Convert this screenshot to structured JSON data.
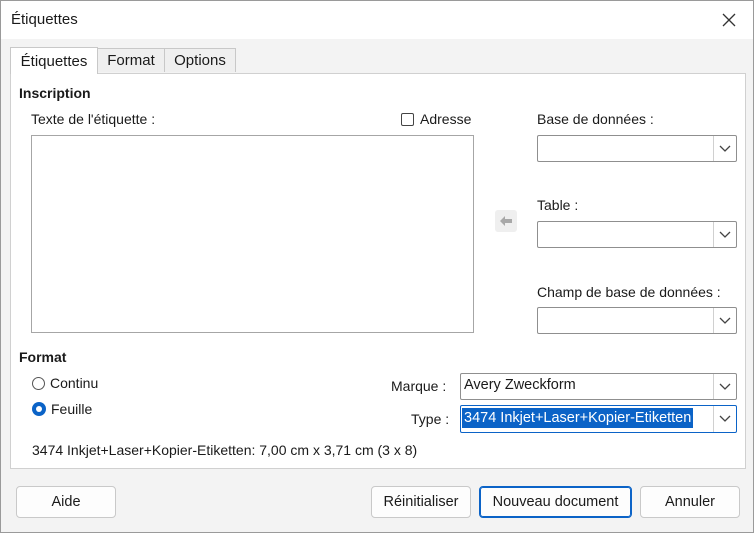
{
  "window": {
    "title": "Étiquettes"
  },
  "tabs": [
    {
      "label": "Étiquettes",
      "active": true
    },
    {
      "label": "Format",
      "active": false
    },
    {
      "label": "Options",
      "active": false
    }
  ],
  "inscription": {
    "title": "Inscription",
    "text_label": "Texte de l'étiquette :",
    "address_label": "Adresse",
    "address_checked": false,
    "text_value": ""
  },
  "database": {
    "db_label": "Base de données :",
    "db_value": "",
    "table_label": "Table :",
    "table_value": "",
    "field_label": "Champ de base de données :",
    "field_value": ""
  },
  "format": {
    "title": "Format",
    "continuous_label": "Continu",
    "sheet_label": "Feuille",
    "selected": "Feuille",
    "brand_label": "Marque :",
    "brand_value": "Avery Zweckform",
    "type_label": "Type :",
    "type_value": "3474 Inkjet+Laser+Kopier-Etiketten",
    "info": "3474 Inkjet+Laser+Kopier-Etiketten: 7,00 cm x 3,71 cm (3 x 8)"
  },
  "buttons": {
    "help": "Aide",
    "reset": "Réinitialiser",
    "new_document": "Nouveau document",
    "cancel": "Annuler"
  },
  "colors": {
    "accent": "#0b63c7",
    "background": "#f3f3f3"
  },
  "icons": {
    "close": "close-icon",
    "insert": "arrow-left-icon",
    "dropdown": "chevron-down-icon"
  }
}
